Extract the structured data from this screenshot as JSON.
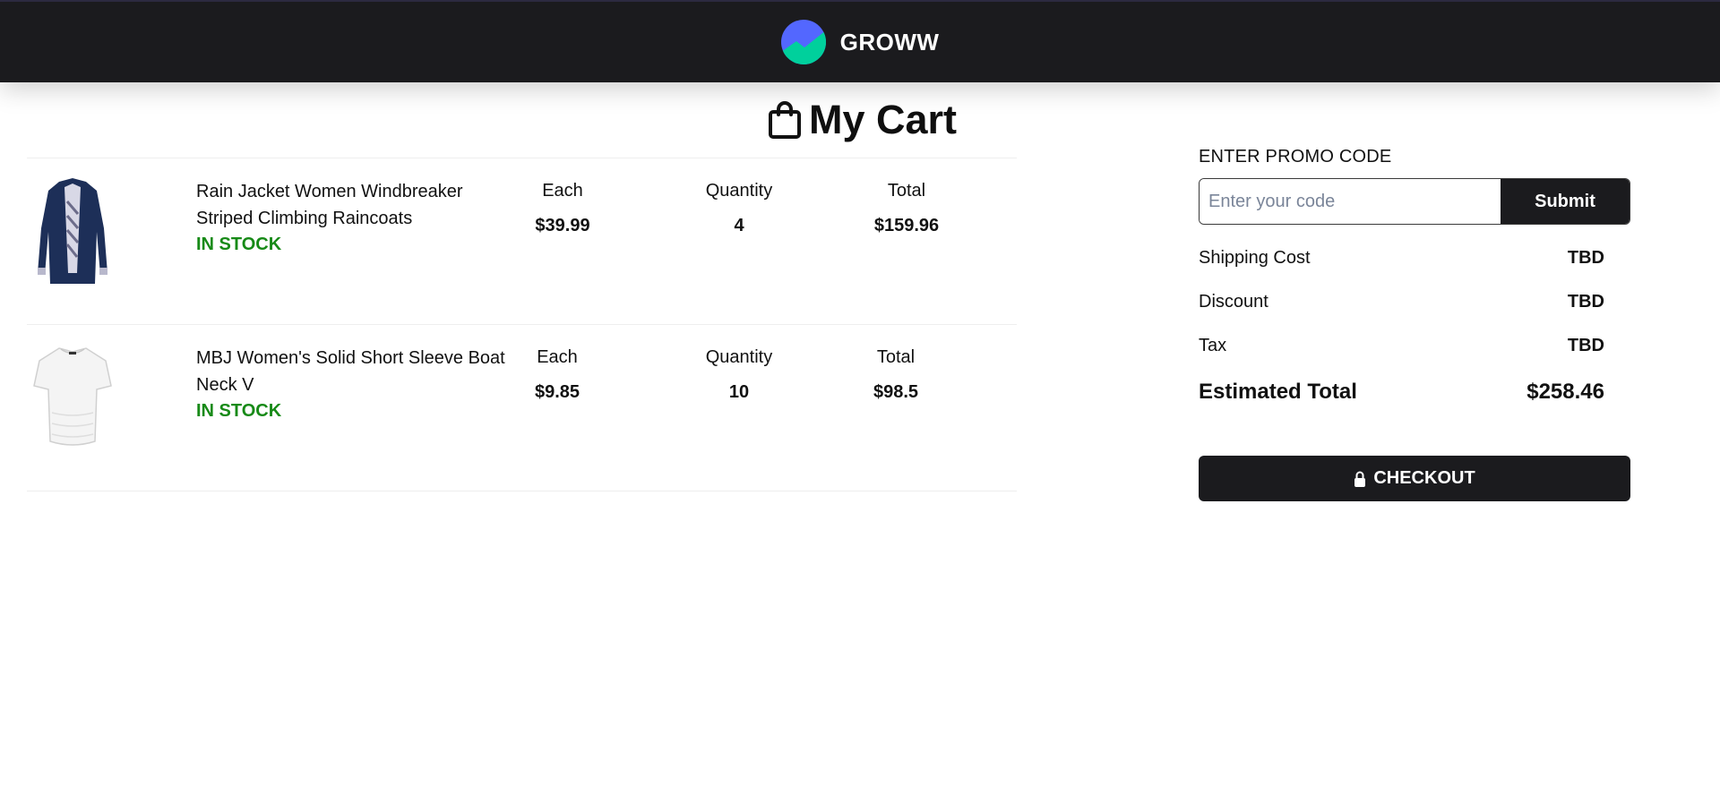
{
  "header": {
    "brand_name": "GROWW",
    "logo_colors": {
      "top": "#5367ff",
      "bottom": "#00d09c"
    }
  },
  "cart": {
    "title": "My Cart",
    "icon": "shopping-bag-icon"
  },
  "columns": {
    "each": "Each",
    "quantity": "Quantity",
    "total": "Total"
  },
  "items": [
    {
      "name_line1": "Rain Jacket Women Windbreaker",
      "name_line2": "Striped Climbing Raincoats",
      "stock": "IN STOCK",
      "each": "$39.99",
      "quantity": "4",
      "total": "$159.96",
      "image_icon": "rain-jacket-image"
    },
    {
      "name_line1": "MBJ Women's Solid Short Sleeve Boat",
      "name_line2": "Neck V",
      "stock": "IN STOCK",
      "each": "$9.85",
      "quantity": "10",
      "total": "$98.5",
      "image_icon": "white-tshirt-image"
    }
  ],
  "summary": {
    "promo_label": "ENTER PROMO CODE",
    "promo_placeholder": "Enter your code",
    "promo_value": "",
    "submit_label": "Submit",
    "shipping_label": "Shipping Cost",
    "shipping_value": "TBD",
    "discount_label": "Discount",
    "discount_value": "TBD",
    "tax_label": "Tax",
    "tax_value": "TBD",
    "total_label": "Estimated Total",
    "total_value": "$258.46"
  },
  "checkout": {
    "label": "CHECKOUT",
    "icon": "lock-icon"
  },
  "colors": {
    "header_bg": "#1b1b1e",
    "in_stock": "#178a17",
    "button_bg": "#1b1b1e"
  }
}
